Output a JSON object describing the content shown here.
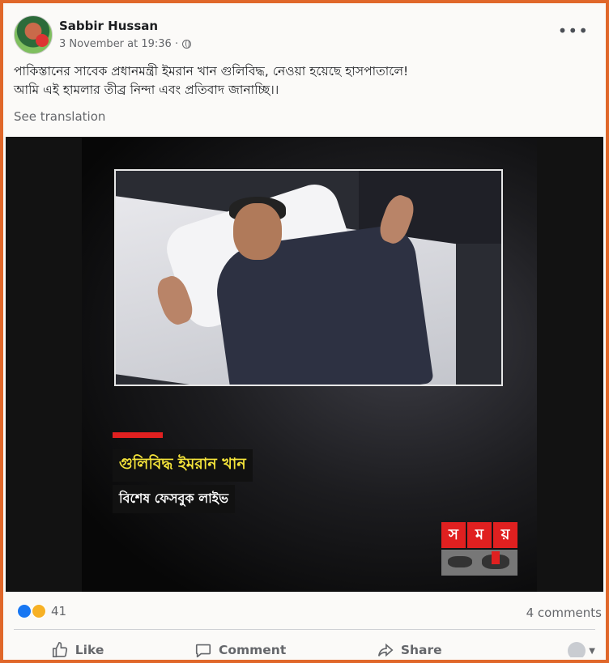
{
  "post": {
    "author": "Sabbir Hussan",
    "timestamp": "3 November at 19:36 ·",
    "text_line1": "পাকিস্তানের সাবেক প্রধানমন্ত্রী ইমরান খান গুলিবিদ্ধ, নেওয়া হয়েছে হাসপাতালে!",
    "text_line2": "আমি এই হামলার তীব্র নিন্দা এবং প্রতিবাদ জানাচ্ছি।।",
    "see_translation": "See translation",
    "more": "•••"
  },
  "video": {
    "caption_headline": "গুলিবিদ্ধ ইমরান খান",
    "caption_sub": "বিশেষ ফেসবুক লাইভ",
    "logo_letters": [
      "স",
      "ম",
      "য়"
    ],
    "accent": "#e02020",
    "headline_color": "#f5e43a"
  },
  "footer": {
    "reaction_count": "41",
    "comments": "4 comments",
    "like": "Like",
    "comment": "Comment",
    "share": "Share"
  },
  "colors": {
    "frame": "#e0672a",
    "like_blue": "#1877f2"
  }
}
